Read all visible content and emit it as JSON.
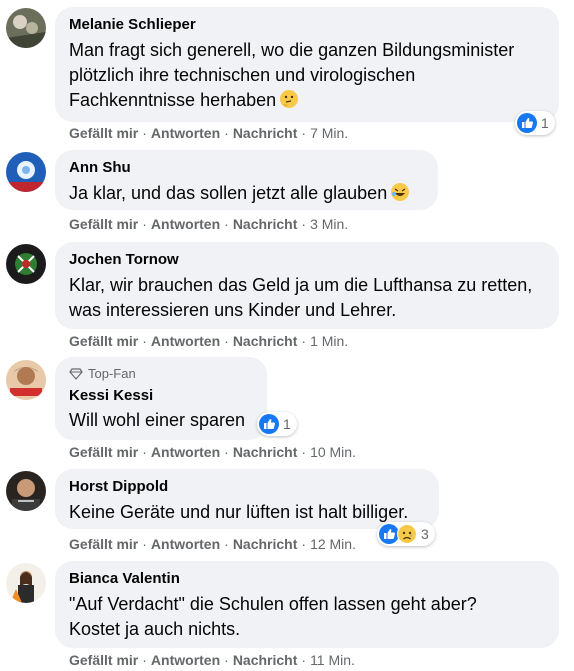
{
  "actions": {
    "like": "Gefällt mir",
    "reply": "Antworten",
    "message": "Nachricht",
    "separator": "·"
  },
  "colors": {
    "bubble": "#f0f2f5",
    "secondary_text": "#65676b",
    "like_blue": "#1877f2"
  },
  "comments": [
    {
      "author": "Melanie Schlieper",
      "text": "Man fragt sich generell, wo die ganzen Bildungsminister plötzlich ihre technischen und virologischen Fachkenntnisse herhaben",
      "emoji": "thinking-face-icon",
      "time": "7 Min.",
      "reaction_count": "1",
      "reactions": [
        "like-icon"
      ]
    },
    {
      "author": "Ann Shu",
      "text": "Ja klar, und das sollen jetzt alle glauben",
      "emoji": "rolling-laughing-icon",
      "time": "3 Min."
    },
    {
      "author": "Jochen Tornow",
      "text": "Klar, wir brauchen das Geld ja um die Lufthansa zu retten, was interessieren uns Kinder und Lehrer.",
      "time": "1 Min."
    },
    {
      "badge": "Top-Fan",
      "author": "Kessi Kessi",
      "text": "Will wohl einer sparen",
      "time": "10 Min.",
      "reaction_count": "1",
      "reactions": [
        "like-icon"
      ]
    },
    {
      "author": "Horst Dippold",
      "text": "Keine Geräte und nur lüften ist halt billiger.",
      "time": "12 Min.",
      "reaction_count": "3",
      "reactions": [
        "like-icon",
        "sad-face-icon"
      ]
    },
    {
      "author": "Bianca Valentin",
      "text": "\"Auf Verdacht\" die Schulen offen lassen geht aber? Kostet ja auch nichts.",
      "time": "11 Min."
    }
  ]
}
